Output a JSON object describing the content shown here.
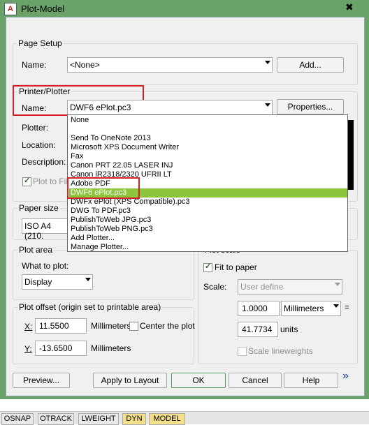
{
  "window": {
    "title": "Plot-Model",
    "close_glyph": "✖"
  },
  "page_setup": {
    "label": "Page Setup",
    "name_label": "Name:",
    "value": "<None>",
    "add_button": "Add..."
  },
  "printer": {
    "label": "Printer/Plotter",
    "name_label": "Name:",
    "value": "DWF6 ePlot.pc3",
    "properties_button": "Properties...",
    "plotter_label": "Plotter:",
    "location_label": "Location:",
    "description_label": "Description:",
    "plot_to_file": "Plot to File",
    "options": [
      "None",
      "",
      "Send To OneNote 2013",
      "Microsoft XPS Document Writer",
      "Fax",
      "Canon PRT 22.05 LASER INJ",
      "Canon iR2318/2320 UFRII LT",
      "Adobe PDF",
      "DWF6 ePlot.pc3",
      "DWFx ePlot (XPS Compatible).pc3",
      "DWG To PDF.pc3",
      "PublishToWeb JPG.pc3",
      "PublishToWeb PNG.pc3",
      "Add Plotter...",
      "Manage Plotter..."
    ]
  },
  "paper_size": {
    "label": "Paper size",
    "value": "ISO A4 (210."
  },
  "plot_area": {
    "label": "Plot area",
    "what_label": "What to plot:",
    "value": "Display"
  },
  "plot_offset": {
    "label": "Plot offset (origin set to printable area)",
    "x_label": "X:",
    "x_value": "11.5500",
    "x_unit": "Millimeters",
    "y_label": "Y:",
    "y_value": "-13.6500",
    "y_unit": "Millimeters",
    "center": "Center the plot"
  },
  "plot_scale": {
    "label": "Plot scale",
    "fit": "Fit to paper",
    "scale_label": "Scale:",
    "scale_value": "User define",
    "num_value": "1.0000",
    "num_unit": "Millimeters",
    "eq": "=",
    "den_value": "41.7734",
    "den_unit": "units",
    "scale_lw": "Scale lineweights"
  },
  "buttons": {
    "preview": "Preview...",
    "apply": "Apply to Layout",
    "ok": "OK",
    "cancel": "Cancel",
    "help": "Help",
    "expand": "»"
  },
  "statusbar": [
    "OSNAP",
    "OTRACK",
    "LWEIGHT",
    "DYN",
    "MODEL"
  ],
  "colors": {
    "selection": "#8cc43c",
    "highlight": "#d42222",
    "frame": "#6aa26a"
  }
}
